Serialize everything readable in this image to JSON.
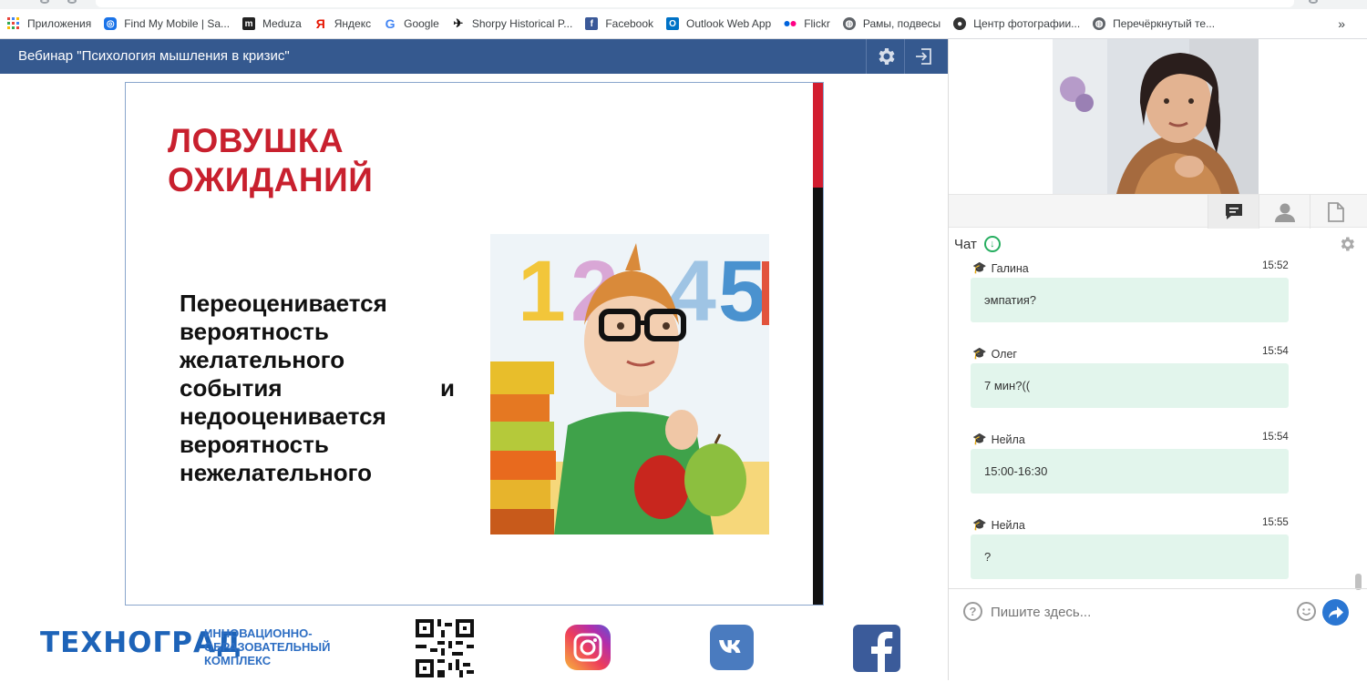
{
  "bookmarks": [
    {
      "label": "Приложения",
      "icon": "apps-grid-icon",
      "color": "#e8453c"
    },
    {
      "label": "Find My Mobile | Sa...",
      "icon": "find-my-mobile-icon",
      "color": "#1a73e8"
    },
    {
      "label": "Meduza",
      "icon": "meduza-icon",
      "color": "#222222"
    },
    {
      "label": "Яндекс",
      "icon": "yandex-icon",
      "color": "#e61400"
    },
    {
      "label": "Google",
      "icon": "google-icon",
      "color": "#4285f4"
    },
    {
      "label": "Shorpy Historical P...",
      "icon": "shorpy-icon",
      "color": "#111111"
    },
    {
      "label": "Facebook",
      "icon": "facebook-icon",
      "color": "#3b5998"
    },
    {
      "label": "Outlook Web App",
      "icon": "outlook-icon",
      "color": "#0072c6"
    },
    {
      "label": "Flickr",
      "icon": "flickr-icon",
      "color": "#ff0084"
    },
    {
      "label": "Рамы, подвесы",
      "icon": "globe-icon",
      "color": "#5f6368"
    },
    {
      "label": "Центр фотографии...",
      "icon": "camera-site-icon",
      "color": "#333333"
    },
    {
      "label": "Перечёркнутый те...",
      "icon": "globe-icon",
      "color": "#5f6368"
    }
  ],
  "bookmarks_more": "»",
  "webinar": {
    "title": "Вебинар \"Психология мышления в кризис\"",
    "header_color": "#35598f"
  },
  "slide": {
    "title_line1": "ЛОВУШКА",
    "title_line2": "ОЖИДАНИЙ",
    "body_lines": [
      "Переоценивается",
      "вероятность",
      "желательного",
      "события",
      "недооценивается",
      "вероятность",
      "нежелательного"
    ],
    "and_word": "и",
    "accent_red": "#d21d2f"
  },
  "footer": {
    "brand": "ТЕХНОГРАД",
    "brand_sub_lines": [
      "ИННОВАЦИОННО-",
      "ОБРАЗОВАТЕЛЬНЫЙ",
      "КОМПЛЕКС"
    ]
  },
  "chat": {
    "title": "Чат",
    "messages": [
      {
        "author": "Галина",
        "time": "15:52",
        "text": "эмпатия?"
      },
      {
        "author": "Олег",
        "time": "15:54",
        "text": "7 мин?(("
      },
      {
        "author": "Нейла",
        "time": "15:54",
        "text": "15:00-16:30"
      },
      {
        "author": "Нейла",
        "time": "15:55",
        "text": "?"
      }
    ],
    "input_placeholder": "Пишите здесь...",
    "help_glyph": "?"
  }
}
